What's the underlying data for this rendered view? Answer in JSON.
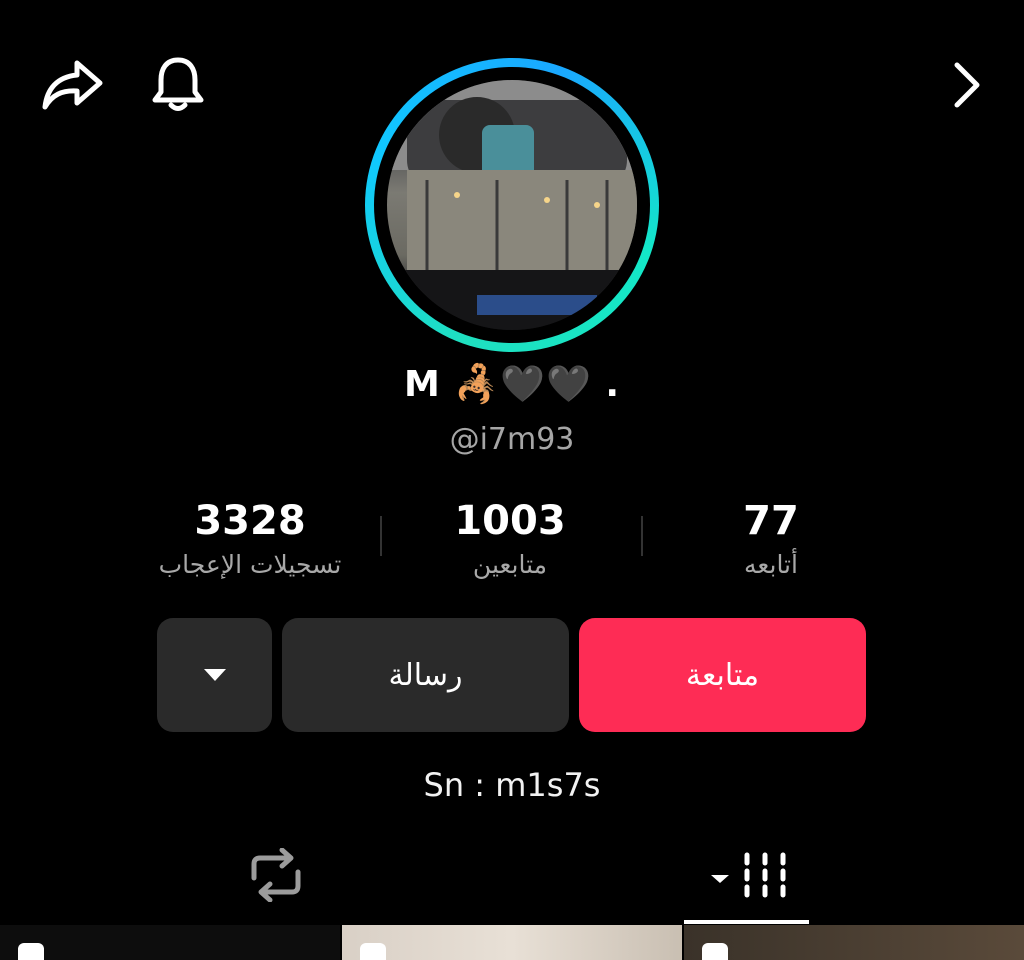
{
  "header": {
    "share_icon": "share-arrow-icon",
    "bell_icon": "bell-icon",
    "next_icon": "chevron-right-icon"
  },
  "profile": {
    "display_name": "M 🦂🖤🖤 .",
    "handle": "@i7m93",
    "bio": "Sn : m1s7s",
    "ring_colors": [
      "#1fe0c0",
      "#10c8ff"
    ]
  },
  "stats": [
    {
      "value": "3328",
      "label": "تسجيلات الإعجاب"
    },
    {
      "value": "1003",
      "label": "متابعين"
    },
    {
      "value": "77",
      "label": "أتابعه"
    }
  ],
  "actions": {
    "follow_label": "متابعة",
    "message_label": "رسالة",
    "more_icon": "caret-down-icon",
    "follow_color": "#fe2c55"
  },
  "tabs": [
    {
      "icon": "repost-icon"
    },
    {
      "icon": "grid-icon",
      "active": true
    }
  ]
}
